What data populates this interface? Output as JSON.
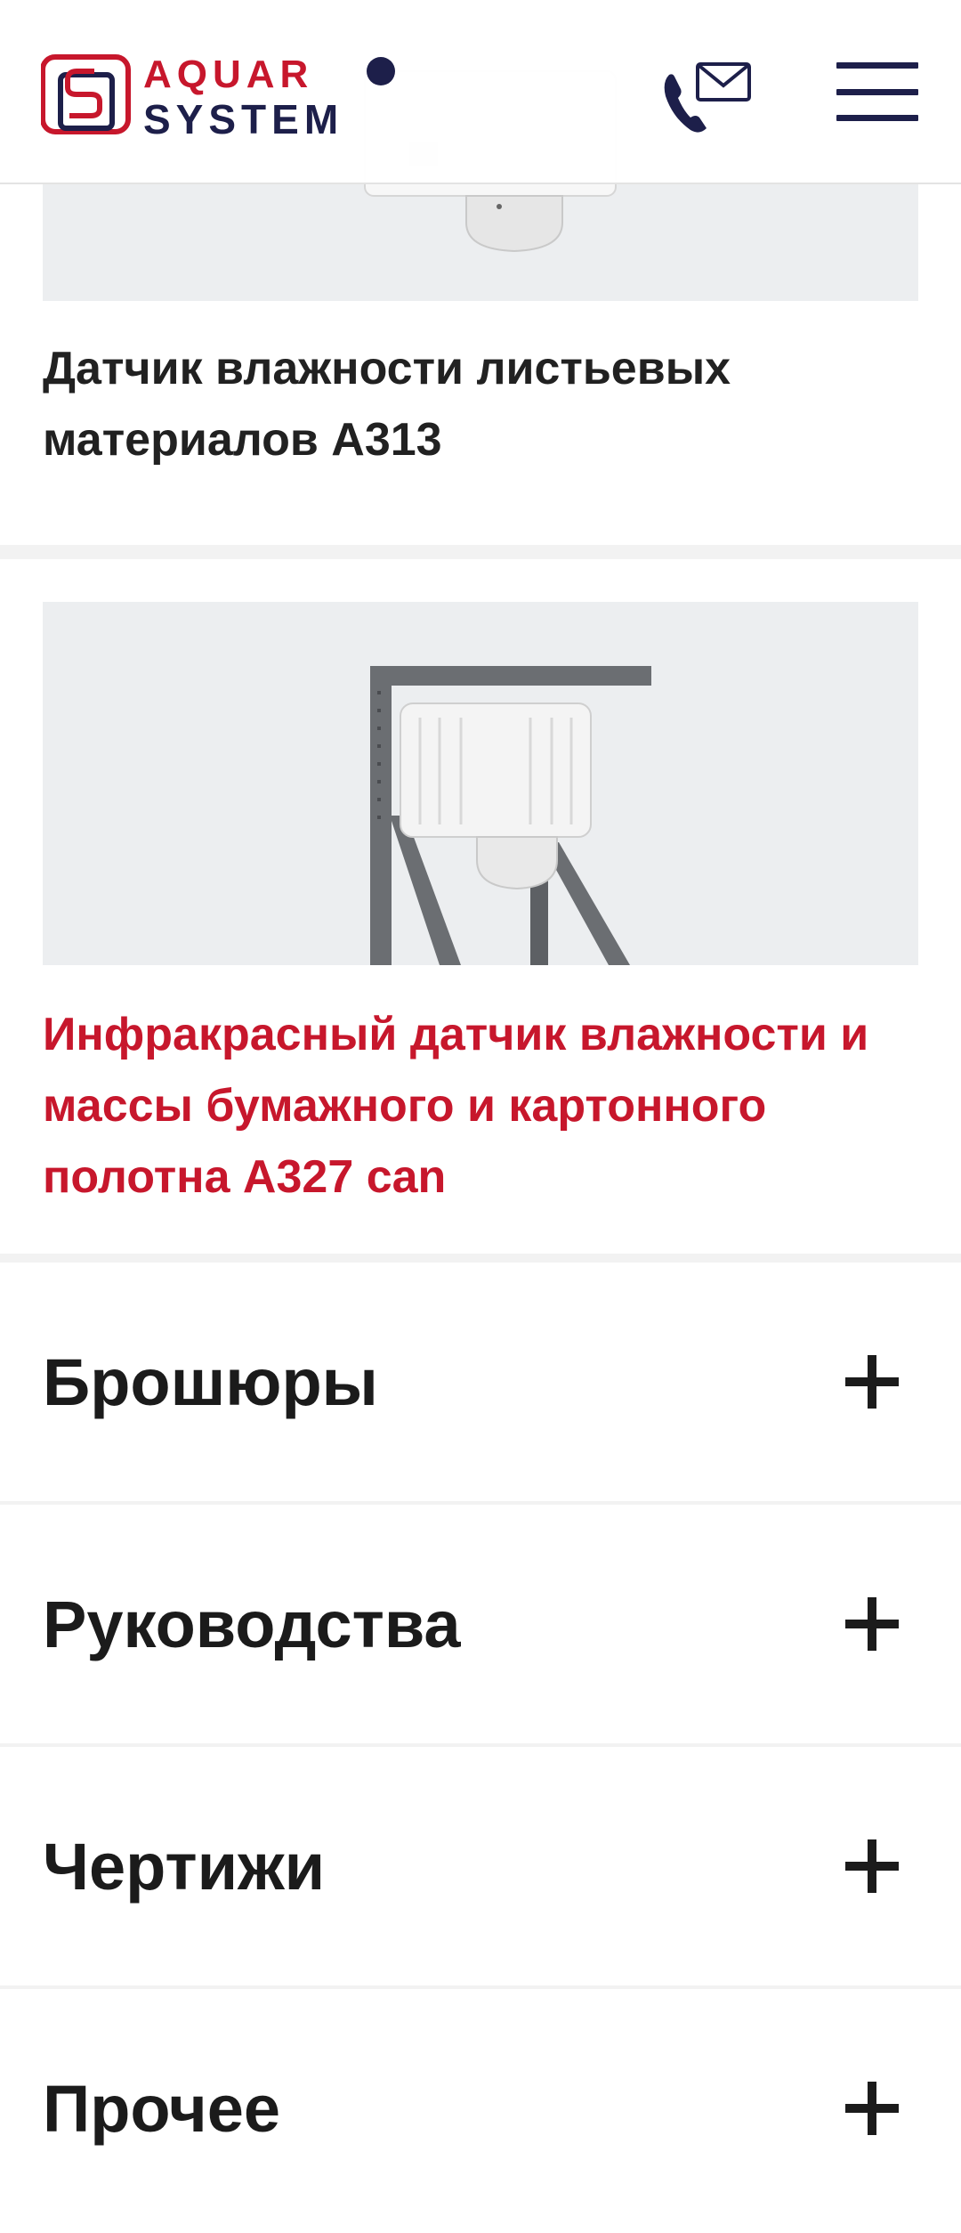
{
  "header": {
    "logo_text_top": "AQUAR",
    "logo_text_bottom": "SYSTEM",
    "contact_icon": "phone-mail-icon",
    "menu_icon": "hamburger-icon"
  },
  "products": [
    {
      "title": "Датчик влажности листьевых материалов A313"
    },
    {
      "title": "Инфракрасный датчик влажности и массы бумажного и картонного полотна A327 can"
    }
  ],
  "accordion": [
    {
      "label": "Брошюры",
      "icon": "plus-icon"
    },
    {
      "label": "Руководства",
      "icon": "plus-icon"
    },
    {
      "label": "Чертижи",
      "icon": "plus-icon"
    },
    {
      "label": "Прочее",
      "icon": "plus-icon"
    }
  ],
  "colors": {
    "brand_navy": "#1d1f4a",
    "brand_red": "#c7172c",
    "text": "#212121",
    "image_bg": "#eceef0"
  }
}
